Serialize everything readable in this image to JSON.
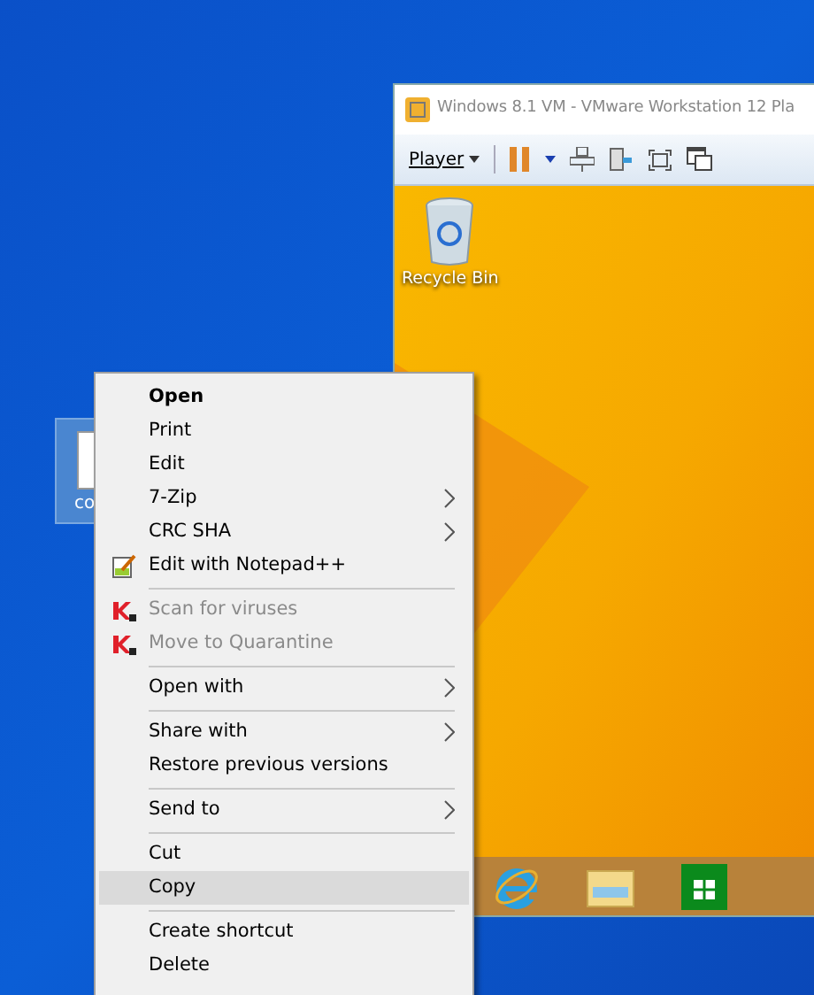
{
  "desktop_file": {
    "label": "co",
    "selected": true
  },
  "vm_window": {
    "title": "Windows 8.1 VM - VMware Workstation 12 Pla",
    "toolbar": {
      "player_menu": "Player"
    },
    "guest_desktop": {
      "recycle_bin": "Recycle Bin"
    }
  },
  "context_menu": [
    {
      "kind": "plain",
      "label": "Open",
      "default": true,
      "disabled": false,
      "submenu": false,
      "selected": false
    },
    {
      "kind": "plain",
      "label": "Print",
      "default": false,
      "disabled": false,
      "submenu": false,
      "selected": false
    },
    {
      "kind": "plain",
      "label": "Edit",
      "default": false,
      "disabled": false,
      "submenu": false,
      "selected": false
    },
    {
      "kind": "plain",
      "label": "7-Zip",
      "default": false,
      "disabled": false,
      "submenu": true,
      "selected": false
    },
    {
      "kind": "plain",
      "label": "CRC SHA",
      "default": false,
      "disabled": false,
      "submenu": true,
      "selected": false
    },
    {
      "kind": "notepad",
      "label": "Edit with Notepad++",
      "default": false,
      "disabled": false,
      "submenu": false,
      "selected": false
    },
    {
      "kind": "separator"
    },
    {
      "kind": "antivirus",
      "label": "Scan for viruses",
      "default": false,
      "disabled": true,
      "submenu": false,
      "selected": false
    },
    {
      "kind": "antivirus",
      "label": "Move to Quarantine",
      "default": false,
      "disabled": true,
      "submenu": false,
      "selected": false
    },
    {
      "kind": "separator"
    },
    {
      "kind": "plain",
      "label": "Open with",
      "default": false,
      "disabled": false,
      "submenu": true,
      "selected": false
    },
    {
      "kind": "separator"
    },
    {
      "kind": "plain",
      "label": "Share with",
      "default": false,
      "disabled": false,
      "submenu": true,
      "selected": false
    },
    {
      "kind": "plain",
      "label": "Restore previous versions",
      "default": false,
      "disabled": false,
      "submenu": false,
      "selected": false
    },
    {
      "kind": "separator"
    },
    {
      "kind": "plain",
      "label": "Send to",
      "default": false,
      "disabled": false,
      "submenu": true,
      "selected": false
    },
    {
      "kind": "separator"
    },
    {
      "kind": "plain",
      "label": "Cut",
      "default": false,
      "disabled": false,
      "submenu": false,
      "selected": false
    },
    {
      "kind": "plain",
      "label": "Copy",
      "default": false,
      "disabled": false,
      "submenu": false,
      "selected": true
    },
    {
      "kind": "separator"
    },
    {
      "kind": "plain",
      "label": "Create shortcut",
      "default": false,
      "disabled": false,
      "submenu": false,
      "selected": false
    },
    {
      "kind": "plain",
      "label": "Delete",
      "default": false,
      "disabled": false,
      "submenu": false,
      "selected": false
    }
  ]
}
